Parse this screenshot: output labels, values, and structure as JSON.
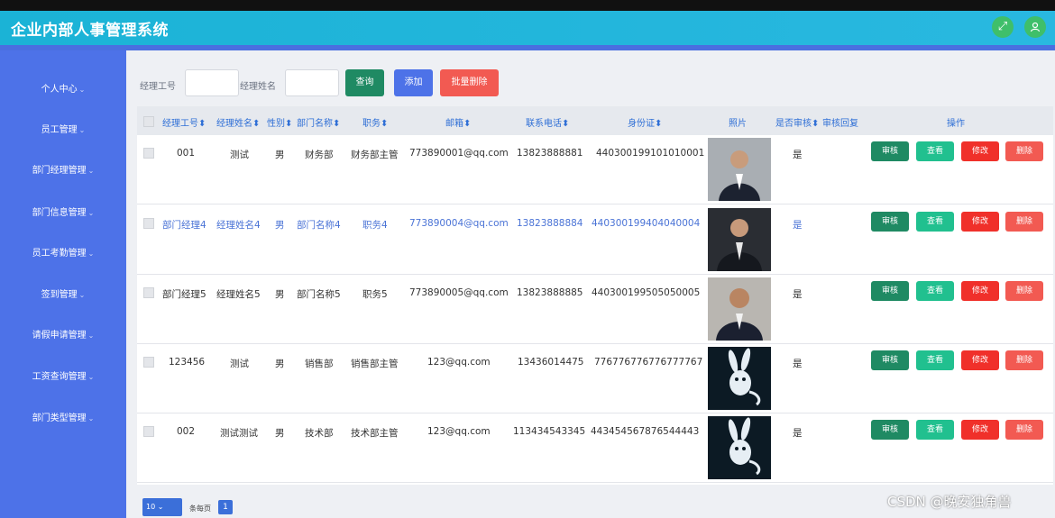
{
  "app": {
    "title": "企业内部人事管理系统"
  },
  "header_icons": [
    {
      "name": "expand-icon",
      "glyph": "⤢"
    },
    {
      "name": "user-icon",
      "glyph": "👤"
    }
  ],
  "sidebar": {
    "items": [
      {
        "label": "个人中心"
      },
      {
        "label": "员工管理"
      },
      {
        "label": "部门经理管理"
      },
      {
        "label": "部门信息管理"
      },
      {
        "label": "员工考勤管理"
      },
      {
        "label": "签到管理"
      },
      {
        "label": "请假申请管理"
      },
      {
        "label": "工资查询管理"
      },
      {
        "label": "部门类型管理"
      }
    ]
  },
  "search": {
    "id_label": "经理工号",
    "name_label": "经理姓名",
    "query_btn": "查询",
    "add_btn": "添加",
    "batch_delete_btn": "批量删除"
  },
  "table": {
    "headers": [
      "经理工号",
      "经理姓名",
      "性别",
      "部门名称",
      "职务",
      "邮箱",
      "联系电话",
      "身份证",
      "照片",
      "是否审核",
      "审核回复",
      "操作"
    ],
    "actions": [
      "审核",
      "查看",
      "修改",
      "删除"
    ],
    "rows": [
      {
        "id": "001",
        "name": "测试",
        "gender": "男",
        "dept": "财务部",
        "position": "财务部主管",
        "email": "773890001@qq.com",
        "phone": "13823888881",
        "idcard": "440300199101010001",
        "photo": "man-suit-1",
        "approved": "是"
      },
      {
        "id": "部门经理4",
        "name": "经理姓名4",
        "gender": "男",
        "dept": "部门名称4",
        "position": "职务4",
        "email": "773890004@qq.com",
        "phone": "13823888884",
        "idcard": "440300199404040004",
        "photo": "man-suit-2",
        "approved": "是"
      },
      {
        "id": "部门经理5",
        "name": "经理姓名5",
        "gender": "男",
        "dept": "部门名称5",
        "position": "职务5",
        "email": "773890005@qq.com",
        "phone": "13823888885",
        "idcard": "440300199505050005",
        "photo": "man-suit-3",
        "approved": "是"
      },
      {
        "id": "123456",
        "name": "测试",
        "gender": "男",
        "dept": "销售部",
        "position": "销售部主管",
        "email": "123@qq.com",
        "phone": "13436014475",
        "idcard": "776776776776777767",
        "photo": "white-rabbit-creature",
        "approved": "是"
      },
      {
        "id": "002",
        "name": "测试测试",
        "gender": "男",
        "dept": "技术部",
        "position": "技术部主管",
        "email": "123@qq.com",
        "phone": "113434543345",
        "idcard": "443454567876544443",
        "photo": "white-rabbit-creature",
        "approved": "是"
      }
    ]
  },
  "pager": {
    "page_size": "10",
    "per_page_label": "条每页",
    "current_page": "1"
  },
  "watermark": "CSDN @晚安独角兽",
  "colors": {
    "header": "#1bb3d6",
    "sidebar": "#4d72e8",
    "audit": "#1f8a63",
    "view": "#21c08f",
    "edit": "#f0302a",
    "delete": "#f25a52",
    "add": "#4d72e8",
    "batch_delete": "#f25a52"
  }
}
